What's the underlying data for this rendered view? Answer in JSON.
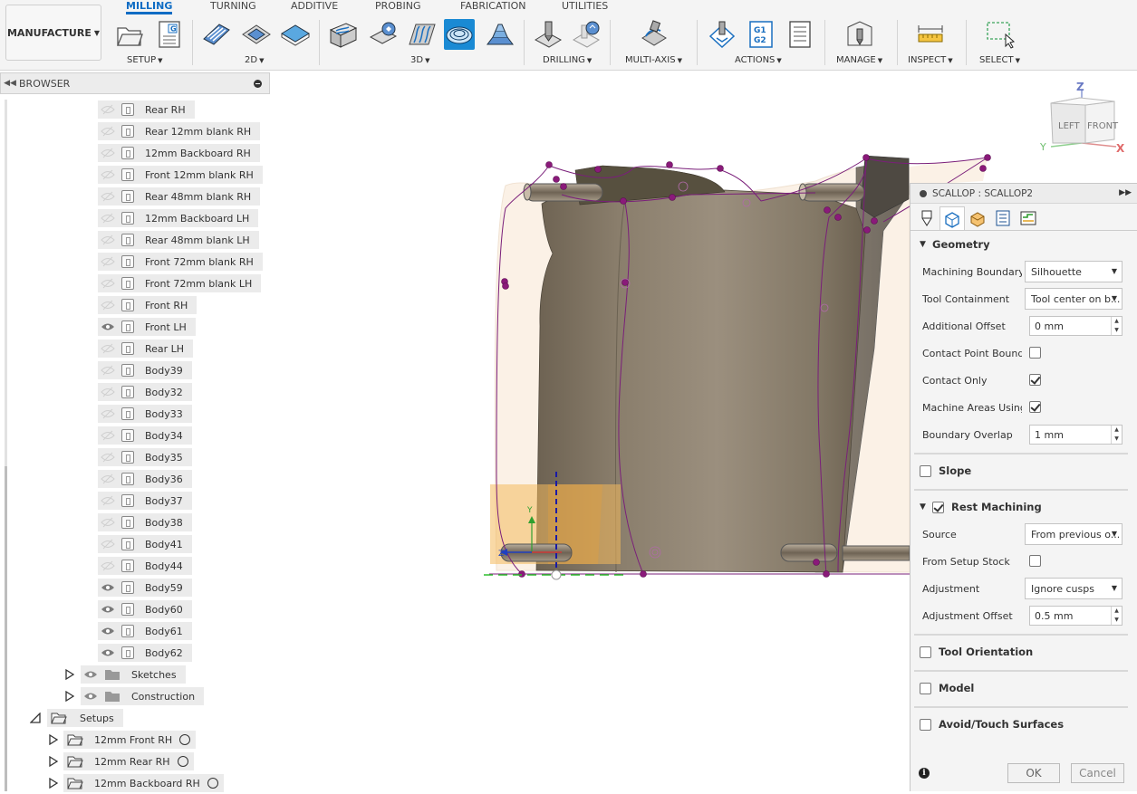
{
  "workspace": {
    "label": "MANUFACTURE"
  },
  "tabs": [
    {
      "label": "MILLING",
      "active": true
    },
    {
      "label": "TURNING"
    },
    {
      "label": "ADDITIVE"
    },
    {
      "label": "PROBING"
    },
    {
      "label": "FABRICATION"
    },
    {
      "label": "UTILITIES"
    }
  ],
  "groups": {
    "setup": "SETUP",
    "two_d": "2D",
    "three_d": "3D",
    "drilling": "DRILLING",
    "multi_axis": "MULTI-AXIS",
    "actions": "ACTIONS",
    "manage": "MANAGE",
    "inspect": "INSPECT",
    "select": "SELECT"
  },
  "icons": {
    "setup": [
      "new-setup-icon",
      "setup-sheet-icon"
    ],
    "two_d": [
      "2d-pocket-icon",
      "2d-adaptive-icon",
      "face-icon"
    ],
    "three_d": [
      "adaptive-clearing-icon",
      "pocket-clearing-icon",
      "steep-shallow-icon",
      "scallop-icon",
      "contour-icon"
    ],
    "drilling": [
      "drill-icon",
      "probe-icon"
    ],
    "multi_axis": "multi-axis-icon",
    "actions": [
      "simulate-icon",
      "post-process-icon",
      "setup-sheet-icon"
    ],
    "manage": "tool-library-icon",
    "inspect": "measure-icon",
    "select": "selection-box-icon"
  },
  "accent_color": "#1a8ad4",
  "browser": {
    "title": "BROWSER",
    "bodies": [
      {
        "label": "Rear RH",
        "visible": false
      },
      {
        "label": "Rear 12mm blank RH",
        "visible": false
      },
      {
        "label": "12mm Backboard RH",
        "visible": false
      },
      {
        "label": "Front 12mm blank RH",
        "visible": false
      },
      {
        "label": "Rear 48mm blank RH",
        "visible": false
      },
      {
        "label": "12mm Backboard LH",
        "visible": false
      },
      {
        "label": "Rear 48mm blank LH",
        "visible": false
      },
      {
        "label": "Front  72mm blank RH",
        "visible": false
      },
      {
        "label": "Front  72mm blank LH",
        "visible": false
      },
      {
        "label": "Front RH",
        "visible": false
      },
      {
        "label": "Front LH",
        "visible": true
      },
      {
        "label": "Rear LH",
        "visible": false
      },
      {
        "label": "Body39",
        "visible": false
      },
      {
        "label": "Body32",
        "visible": false
      },
      {
        "label": "Body33",
        "visible": false
      },
      {
        "label": "Body34",
        "visible": false
      },
      {
        "label": "Body35",
        "visible": false
      },
      {
        "label": "Body36",
        "visible": false
      },
      {
        "label": "Body37",
        "visible": false
      },
      {
        "label": "Body38",
        "visible": false
      },
      {
        "label": "Body41",
        "visible": false
      },
      {
        "label": "Body44",
        "visible": false
      },
      {
        "label": "Body59",
        "visible": true
      },
      {
        "label": "Body60",
        "visible": true
      },
      {
        "label": "Body61",
        "visible": true
      },
      {
        "label": "Body62",
        "visible": true
      }
    ],
    "folders": [
      {
        "label": "Sketches"
      },
      {
        "label": "Construction"
      }
    ],
    "setups_label": "Setups",
    "setups": [
      {
        "label": "12mm Front RH"
      },
      {
        "label": "12mm Rear RH"
      },
      {
        "label": "12mm Backboard RH"
      }
    ]
  },
  "viewcube": {
    "left": "LEFT",
    "front": "FRONT",
    "axis_z": "Z",
    "axis_x": "X",
    "axis_y": "Y"
  },
  "dialog": {
    "title": "SCALLOP : SCALLOP2",
    "tab_icons": [
      "tool-tab-icon",
      "geometry-tab-icon",
      "heights-tab-icon",
      "passes-tab-icon",
      "linking-tab-icon"
    ],
    "geometry": {
      "title": "Geometry",
      "machining_boundary_label": "Machining Boundary",
      "machining_boundary_value": "Silhouette",
      "tool_containment_label": "Tool Containment",
      "tool_containment_value": "Tool center on b...",
      "additional_offset_label": "Additional Offset",
      "additional_offset_value": "0 mm",
      "contact_point_label": "Contact Point Boundi...",
      "contact_point_checked": false,
      "contact_only_label": "Contact Only",
      "contact_only_checked": true,
      "machine_areas_label": "Machine Areas Using...",
      "machine_areas_checked": true,
      "boundary_overlap_label": "Boundary Overlap",
      "boundary_overlap_value": "1 mm"
    },
    "slope": {
      "title": "Slope",
      "checked": false
    },
    "rest": {
      "title": "Rest Machining",
      "checked": true,
      "source_label": "Source",
      "source_value": "From previous o...",
      "from_setup_stock_label": "From Setup Stock",
      "from_setup_stock_checked": false,
      "adjustment_label": "Adjustment",
      "adjustment_value": "Ignore cusps",
      "adjustment_offset_label": "Adjustment Offset",
      "adjustment_offset_value": "0.5 mm"
    },
    "tool_orientation": {
      "title": "Tool Orientation",
      "checked": false
    },
    "model": {
      "title": "Model",
      "checked": false
    },
    "avoid": {
      "title": "Avoid/Touch Surfaces",
      "checked": false
    },
    "ok_label": "OK",
    "cancel_label": "Cancel"
  }
}
